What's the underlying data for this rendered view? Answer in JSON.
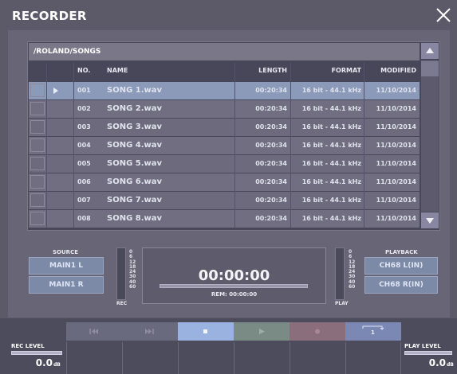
{
  "window": {
    "title": "RECORDER",
    "close_icon": "close-icon"
  },
  "list": {
    "path": "/ROLAND/SONGS",
    "columns": {
      "no": "NO.",
      "name": "NAME",
      "length": "LENGTH",
      "format": "FORMAT",
      "modified": "MODIFIED"
    },
    "selected_index": 0,
    "rows": [
      {
        "no": "001",
        "name": "SONG 1.wav",
        "length": "00:20:34",
        "format": "16 bit - 44.1 kHz",
        "modified": "11/10/2014"
      },
      {
        "no": "002",
        "name": "SONG 2.wav",
        "length": "00:20:34",
        "format": "16 bit - 44.1 kHz",
        "modified": "11/10/2014"
      },
      {
        "no": "003",
        "name": "SONG 3.wav",
        "length": "00:20:34",
        "format": "16 bit - 44.1 kHz",
        "modified": "11/10/2014"
      },
      {
        "no": "004",
        "name": "SONG 4.wav",
        "length": "00:20:34",
        "format": "16 bit - 44.1 kHz",
        "modified": "11/10/2014"
      },
      {
        "no": "005",
        "name": "SONG 5.wav",
        "length": "00:20:34",
        "format": "16 bit - 44.1 kHz",
        "modified": "11/10/2014"
      },
      {
        "no": "006",
        "name": "SONG 6.wav",
        "length": "00:20:34",
        "format": "16 bit - 44.1 kHz",
        "modified": "11/10/2014"
      },
      {
        "no": "007",
        "name": "SONG 7.wav",
        "length": "00:20:34",
        "format": "16 bit - 44.1 kHz",
        "modified": "11/10/2014"
      },
      {
        "no": "008",
        "name": "SONG 8.wav",
        "length": "00:20:34",
        "format": "16 bit - 44.1 kHz",
        "modified": "11/10/2014"
      }
    ]
  },
  "source": {
    "label": "SOURCE",
    "buttons": [
      "MAIN1 L",
      "MAIN1 R"
    ]
  },
  "playback": {
    "label": "PLAYBACK",
    "buttons": [
      "CH68 L(IN)",
      "CH68 R(IN)"
    ]
  },
  "meters": {
    "scale": [
      "0",
      "6",
      "12",
      "18",
      "24",
      "30",
      "40",
      "60"
    ],
    "rec_label": "REC",
    "play_label": "PLAY"
  },
  "display": {
    "time": "00:00:00",
    "remaining": "REM: 00:00:00",
    "progress": 0
  },
  "transport": {
    "icons": [
      "rewind-icon",
      "fast-forward-icon",
      "stop-icon",
      "play-icon",
      "record-icon",
      "repeat-one-icon"
    ],
    "repeat_label": "1"
  },
  "rec_level": {
    "label": "REC LEVEL",
    "value": "0.0",
    "unit": "dB"
  },
  "play_level": {
    "label": "PLAY LEVEL",
    "value": "0.0",
    "unit": "dB"
  },
  "colors": {
    "selected_row": "#8a9ab8",
    "stop_active": "#9ab2e0",
    "record_button": "#8a6e7c",
    "repeat_button": "#7c88b4"
  }
}
